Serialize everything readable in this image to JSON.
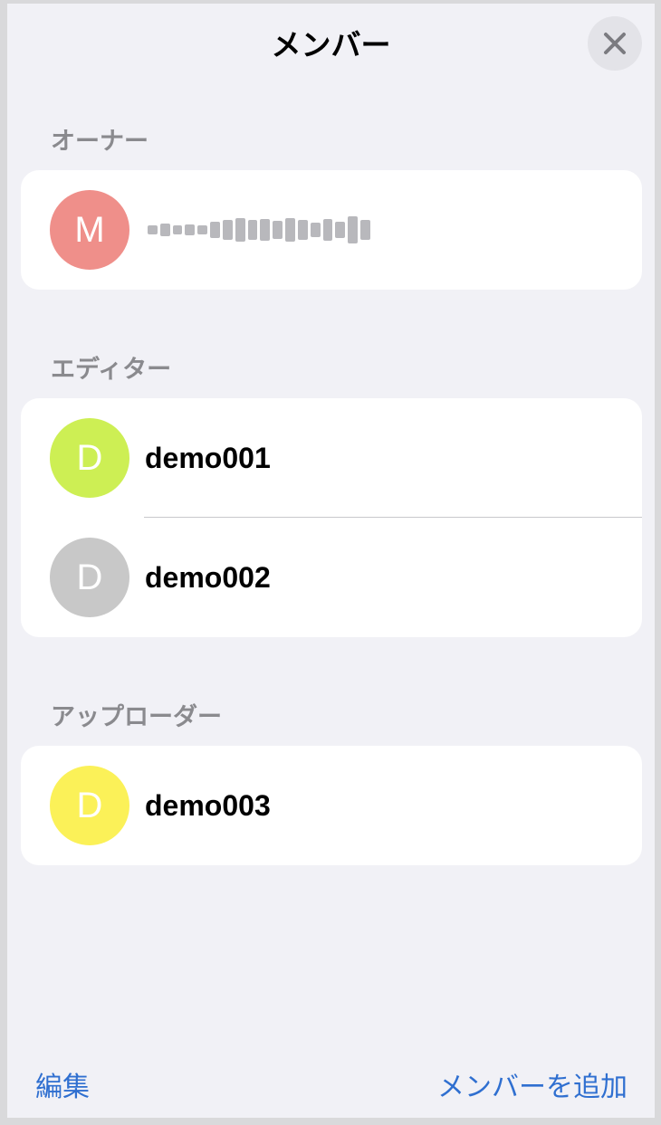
{
  "header": {
    "title": "メンバー",
    "close_icon": "close-icon"
  },
  "sections": {
    "owner": {
      "label": "オーナー",
      "members": [
        {
          "initial": "M",
          "name": "(blurred)",
          "color": "#ef8f8a"
        }
      ]
    },
    "editor": {
      "label": "エディター",
      "members": [
        {
          "initial": "D",
          "name": "demo001",
          "color": "#cdef54"
        },
        {
          "initial": "D",
          "name": "demo002",
          "color": "#c8c8c8"
        }
      ]
    },
    "uploader": {
      "label": "アップローダー",
      "members": [
        {
          "initial": "D",
          "name": "demo003",
          "color": "#fbf158"
        }
      ]
    }
  },
  "footer": {
    "edit_label": "編集",
    "add_member_label": "メンバーを追加",
    "accent_color": "#2f6fd0"
  }
}
